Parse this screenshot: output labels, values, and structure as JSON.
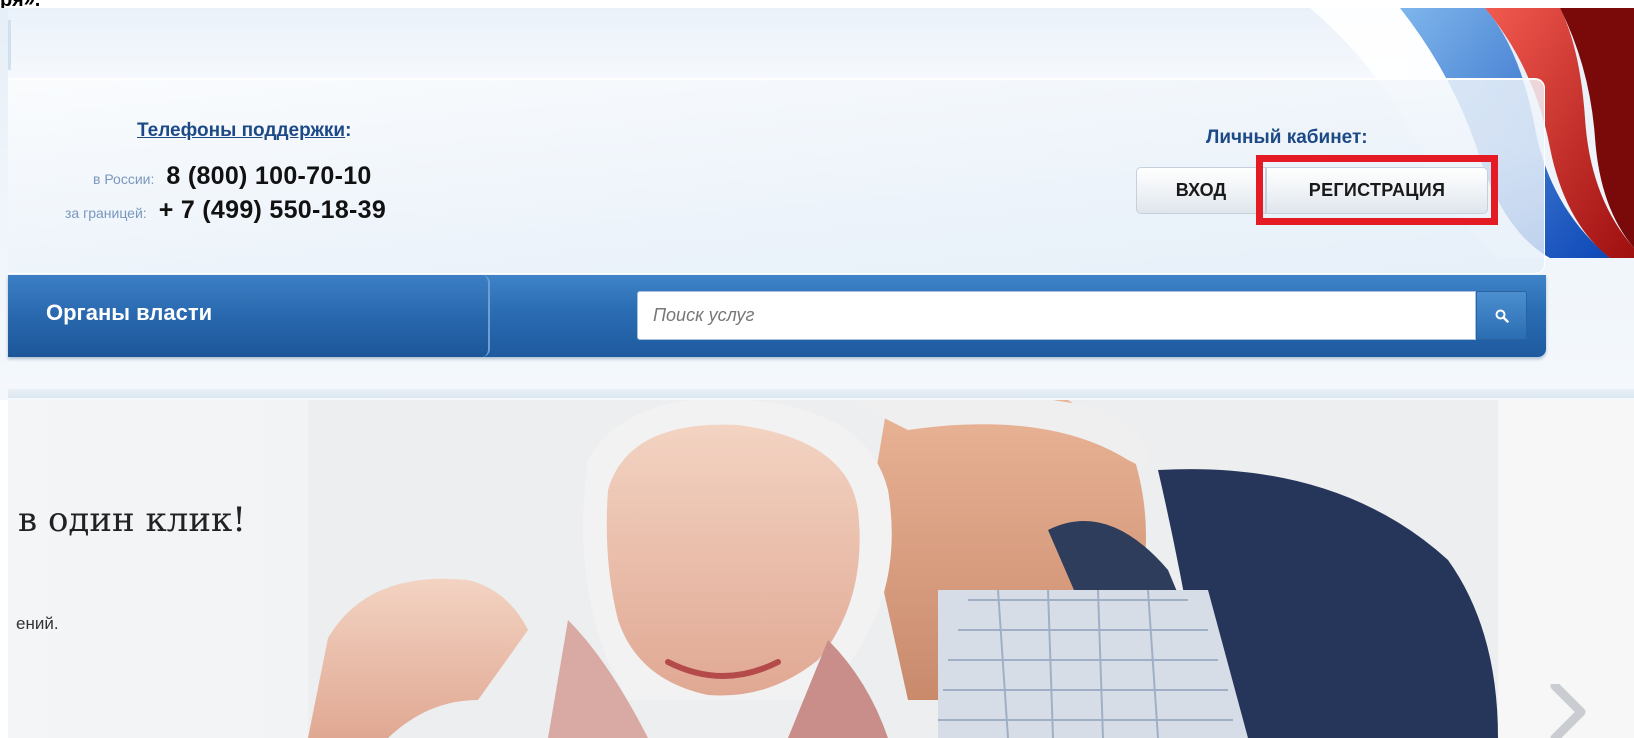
{
  "top_fragment": "ря».",
  "support": {
    "title": "Телефоны поддержки",
    "title_suffix": ":",
    "russia_label": "в России:",
    "russia_phone": "8 (800) 100-70-10",
    "abroad_label": "за границей:",
    "abroad_phone": "+ 7 (499) 550-18-39"
  },
  "cabinet": {
    "title": "Личный кабинет:",
    "login_label": "ВХОД",
    "register_label": "РЕГИСТРАЦИЯ",
    "highlight_color": "#e41b24"
  },
  "nav": {
    "authorities_label": "Органы власти"
  },
  "search": {
    "placeholder": "Поиск услуг",
    "value": "",
    "icon": "search-icon"
  },
  "hero": {
    "title": "в один клик!",
    "text": "ений.",
    "next_icon": "chevron-right-icon"
  },
  "colors": {
    "brand_blue": "#1d4a87",
    "nav_blue": "#2a6cb2",
    "flag_red": "#d52b1e",
    "flag_blue": "#0c47b7"
  }
}
